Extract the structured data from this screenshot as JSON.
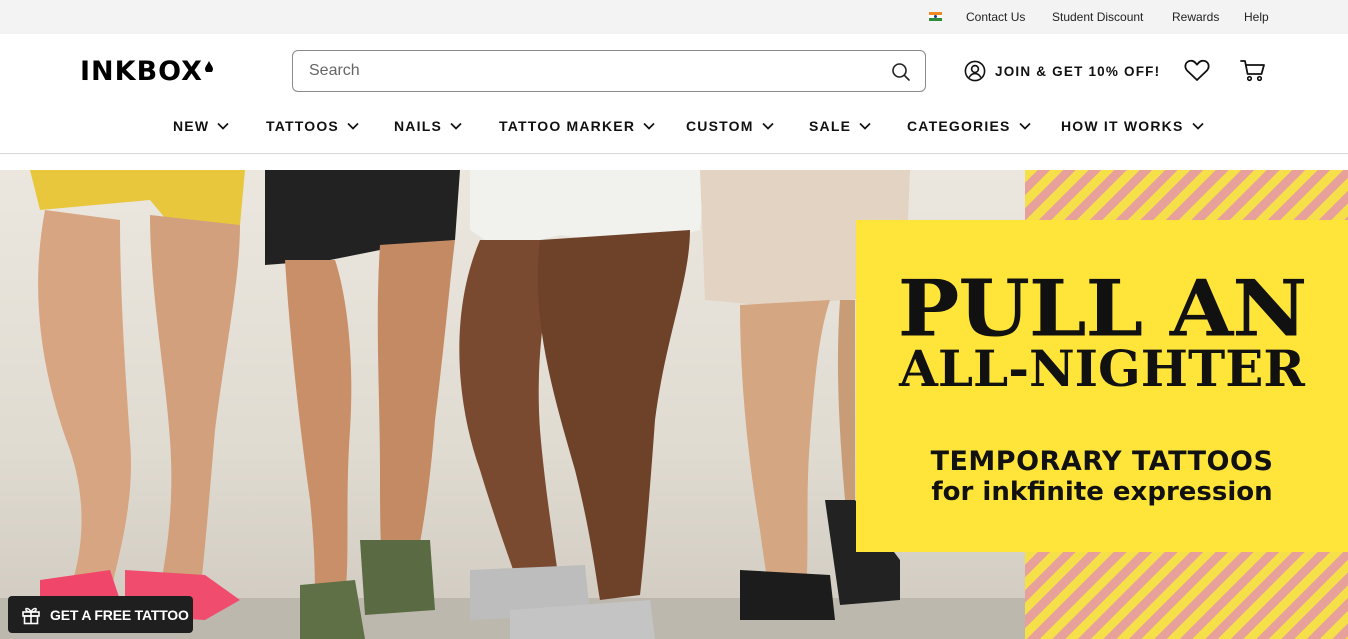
{
  "utility_nav": {
    "flag": "india-flag-icon",
    "links": [
      "Contact Us",
      "Student Discount",
      "Rewards",
      "Help"
    ]
  },
  "header": {
    "logo_text": "INKBOX",
    "search": {
      "placeholder": "Search",
      "value": ""
    },
    "account_label": "JOIN & GET 10% OFF!",
    "icons": [
      "account-icon",
      "wishlist-heart-icon",
      "cart-icon",
      "search-icon"
    ]
  },
  "nav": {
    "items": [
      "NEW",
      "TATTOOS",
      "NAILS",
      "TATTOO MARKER",
      "CUSTOM",
      "SALE",
      "CATEGORIES",
      "HOW IT WORKS"
    ]
  },
  "hero": {
    "headline_1": "PULL AN",
    "headline_2": "ALL-NIGHTER",
    "subhead_1": "TEMPORARY TATTOOS",
    "subhead_2": "for inkfinite expression",
    "colors": {
      "panel": "#ffe53a",
      "stripe_yellow": "#f6e04a",
      "stripe_pink": "#e8a09a"
    }
  },
  "promo_button": {
    "label": "GET A FREE TATTOO",
    "icon": "gift-icon"
  }
}
